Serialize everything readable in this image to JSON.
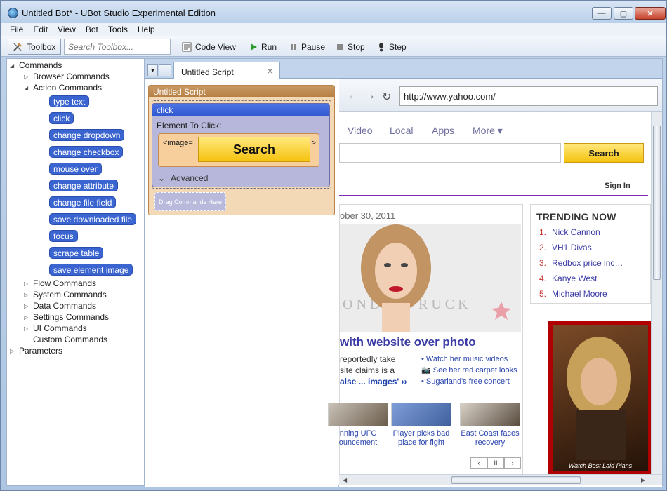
{
  "window": {
    "title": "Untitled Bot* - UBot Studio Experimental Edition",
    "minimize": "—",
    "maximize": "▢",
    "close": "✕"
  },
  "menu": [
    "File",
    "Edit",
    "View",
    "Bot",
    "Tools",
    "Help"
  ],
  "toolbar": {
    "toolbox_label": "Toolbox",
    "search_placeholder": "Search Toolbox...",
    "code_view": "Code View",
    "run": "Run",
    "pause": "Pause",
    "stop": "Stop",
    "step": "Step"
  },
  "tree": {
    "commands": "Commands",
    "browser_commands": "Browser Commands",
    "action_commands": "Action Commands",
    "actions": [
      "type text",
      "click",
      "change dropdown",
      "change checkbox",
      "mouse over",
      "change attribute",
      "change file field",
      "save downloaded file",
      "focus",
      "scrape table",
      "save element image"
    ],
    "flow_commands": "Flow Commands",
    "system_commands": "System Commands",
    "data_commands": "Data Commands",
    "settings_commands": "Settings Commands",
    "ui_commands": "UI Commands",
    "custom_commands": "Custom Commands",
    "parameters": "Parameters"
  },
  "doc_tab": {
    "label": "Untitled Script",
    "close": "✕"
  },
  "script": {
    "title": "Untitled Script",
    "command": "click",
    "element_label": "Element To Click:",
    "element_prefix": "<image=",
    "element_suffix": ">",
    "element_image_text": "Search",
    "advanced": "Advanced",
    "drag_here": "Drag Commands Here"
  },
  "browser": {
    "url": "http://www.yahoo.com/",
    "tabs": [
      "Video",
      "Local",
      "Apps",
      "More ▾"
    ],
    "search_button": "Search",
    "sign_in": "Sign In",
    "date": "ober 30, 2011",
    "headline": "with website over photo",
    "teaser_1": "reportedly take",
    "teaser_2": "site claims is a",
    "teaser_link": "alse ... images' ››",
    "bullets": [
      "Watch her music videos",
      "See her red carpet looks",
      "Sugarland's free concert"
    ],
    "thumbs": [
      {
        "line1": "nning UFC",
        "line2": "ouncement"
      },
      {
        "line1": "Player picks bad",
        "line2": "place for fight"
      },
      {
        "line1": "East Coast faces",
        "line2": "recovery"
      }
    ],
    "pager": [
      "‹",
      "II",
      "›"
    ],
    "trending_title": "TRENDING NOW",
    "trending": [
      {
        "n": "1.",
        "label": "Nick Cannon"
      },
      {
        "n": "2.",
        "label": "VH1 Divas"
      },
      {
        "n": "3.",
        "label": "Redbox price inc…"
      },
      {
        "n": "4.",
        "label": "Kanye West"
      },
      {
        "n": "5.",
        "label": "Michael Moore"
      }
    ],
    "ad_caption": "Watch Best Laid Plans"
  },
  "colors": {
    "pill": "#3a64cf",
    "script_bg": "#f4d9b7",
    "yahoo_purple": "#7d2bb1",
    "search_yellow": "#f5c20e"
  }
}
